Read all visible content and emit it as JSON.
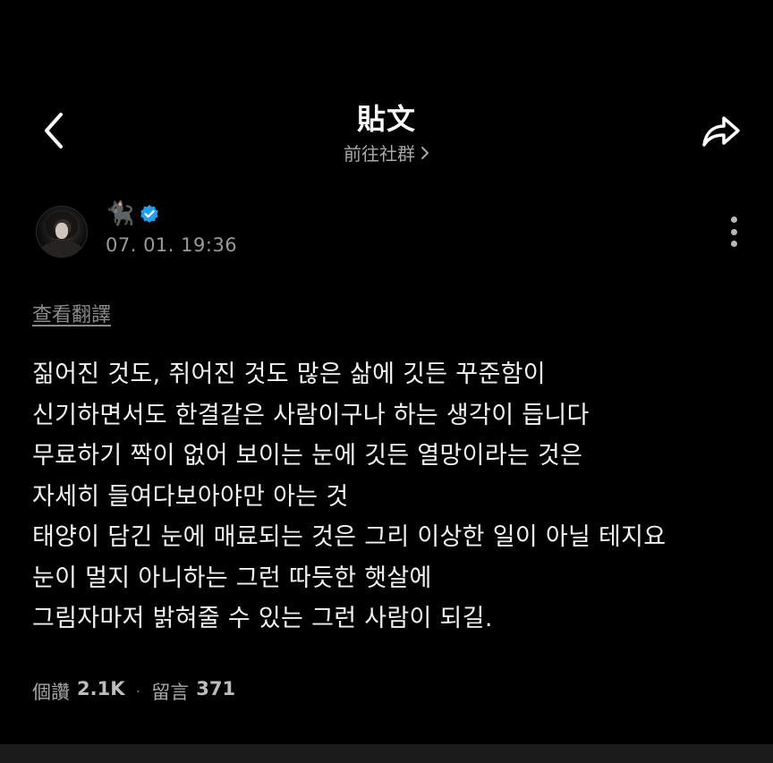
{
  "header": {
    "title": "貼文",
    "community_link": "前往社群"
  },
  "author": {
    "name_glyph": "🐈‍⬛",
    "timestamp": "07. 01. 19:36",
    "verified_color": "#1DA1F2"
  },
  "translate_label": "查看翻譯",
  "post": {
    "lines": [
      "짊어진 것도, 쥐어진 것도 많은 삶에 깃든 꾸준함이",
      "신기하면서도 한결같은 사람이구나 하는 생각이 듭니다",
      "무료하기 짝이 없어 보이는 눈에 깃든 열망이라는 것은",
      "자세히 들여다보아야만 아는 것",
      "태양이 담긴 눈에 매료되는 것은 그리 이상한 일이 아닐 테지요",
      "눈이 멀지 아니하는 그런 따듯한 햇살에",
      "그림자마저 밝혀줄 수 있는 그런 사람이 되길."
    ]
  },
  "stats": {
    "likes_label": "個讚",
    "likes_count": "2.1K",
    "separator": "·",
    "comments_label": "留言",
    "comments_count": "371"
  },
  "icons": {
    "back": "chevron-left-icon",
    "share": "share-arrow-icon",
    "more": "more-vertical-icon",
    "verified": "verified-badge-icon",
    "community_chevron": "chevron-right-icon"
  },
  "colors": {
    "background": "#000000",
    "text_primary": "#ffffff",
    "text_secondary": "#9a9a9a"
  }
}
